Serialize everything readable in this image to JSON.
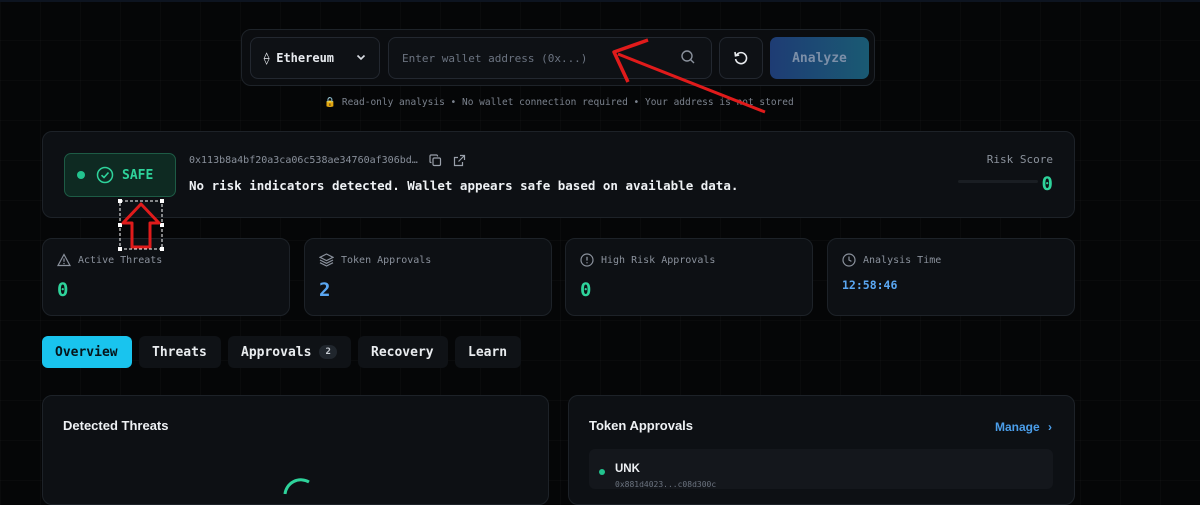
{
  "search": {
    "chain_label": "Ethereum",
    "address_placeholder": "Enter wallet address (0x...)",
    "analyze_label": "Analyze",
    "note": "Read-only analysis • No wallet connection required • Your address is not stored",
    "note_icon": "lock-icon"
  },
  "status": {
    "badge": "SAFE",
    "address": "0x113b8a4bf20a3ca06c538ae34760af306bd…",
    "message": "No risk indicators detected. Wallet appears safe based on available data.",
    "risk_label": "Risk Score",
    "risk_value": "0",
    "risk_fraction": 0,
    "safe_color": "#2ed39b"
  },
  "stats": [
    {
      "label": "Active Threats",
      "value": "0",
      "icon": "warning-icon",
      "color": "#2ed39b"
    },
    {
      "label": "Token Approvals",
      "value": "2",
      "icon": "layers-icon",
      "color": "#5aa7f2"
    },
    {
      "label": "High Risk Approvals",
      "value": "0",
      "icon": "alert-circle-icon",
      "color": "#2ed39b"
    },
    {
      "label": "Analysis Time",
      "value": "12:58:46",
      "icon": "clock-icon",
      "color": "#5aa7f2"
    }
  ],
  "tabs": [
    {
      "label": "Overview",
      "active": true
    },
    {
      "label": "Threats"
    },
    {
      "label": "Approvals",
      "count": "2"
    },
    {
      "label": "Recovery"
    },
    {
      "label": "Learn"
    }
  ],
  "threats_panel": {
    "title": "Detected Threats"
  },
  "approvals_panel": {
    "title": "Token Approvals",
    "manage_label": "Manage",
    "rows": [
      {
        "symbol": "UNK",
        "sub": "0x881d4023...c08d300c"
      }
    ]
  },
  "accent_color": "#19c4ee",
  "annotation_color": "#e01b1b"
}
